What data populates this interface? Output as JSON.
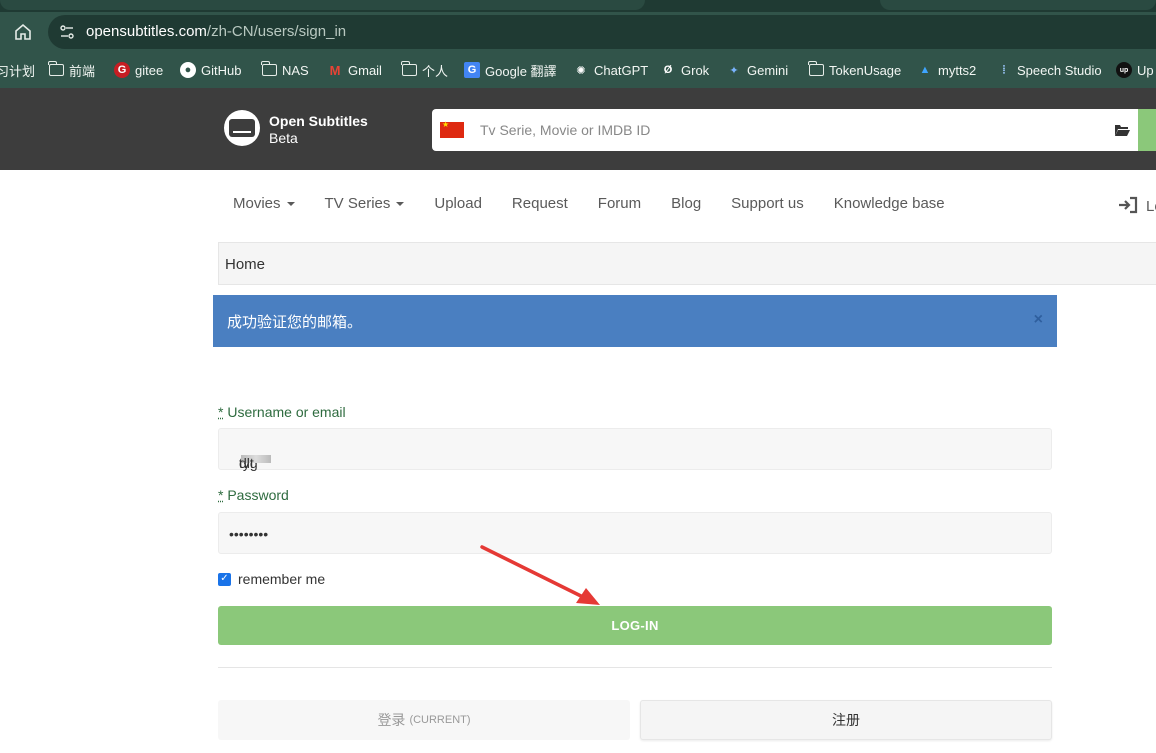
{
  "browser": {
    "url_host": "opensubtitles.com",
    "url_path": "/zh-CN/users/sign_in",
    "bookmarks": [
      {
        "label": "习计划",
        "icon": "folder-icon"
      },
      {
        "label": "前端",
        "icon": "folder-icon"
      },
      {
        "label": "gitee",
        "icon": "gitee-icon"
      },
      {
        "label": "GitHub",
        "icon": "github-icon"
      },
      {
        "label": "NAS",
        "icon": "folder-icon"
      },
      {
        "label": "Gmail",
        "icon": "gmail-icon"
      },
      {
        "label": "个人",
        "icon": "folder-icon"
      },
      {
        "label": "Google 翻譯",
        "icon": "google-translate-icon"
      },
      {
        "label": "ChatGPT",
        "icon": "chatgpt-icon"
      },
      {
        "label": "Grok",
        "icon": "grok-icon"
      },
      {
        "label": "Gemini",
        "icon": "gemini-icon"
      },
      {
        "label": "TokenUsage",
        "icon": "folder-icon"
      },
      {
        "label": "mytts2",
        "icon": "azure-icon"
      },
      {
        "label": "Speech Studio",
        "icon": "speech-icon"
      },
      {
        "label": "Up",
        "icon": "up-icon"
      }
    ]
  },
  "site": {
    "title": "Open Subtitles",
    "subtitle": "Beta",
    "search_placeholder": "Tv Serie, Movie or IMDB ID"
  },
  "nav": {
    "movies": "Movies",
    "tv_series": "TV Series",
    "upload": "Upload",
    "request": "Request",
    "forum": "Forum",
    "blog": "Blog",
    "support": "Support us",
    "knowledge": "Knowledge base",
    "login": "Lo"
  },
  "breadcrumb": {
    "home": "Home"
  },
  "alert": {
    "message": "成功验证您的邮箱。",
    "close": "×"
  },
  "form": {
    "required_mark": "*",
    "username_label": "Username or email",
    "username_prefix": "tyg",
    "username_suffix": "dlt",
    "password_label": "Password",
    "password_value": "••••••••",
    "remember_label": "remember me",
    "submit_label": "LOG-IN"
  },
  "tabs": {
    "login_label": "登录",
    "login_current": "(CURRENT)",
    "register_label": "注册"
  }
}
